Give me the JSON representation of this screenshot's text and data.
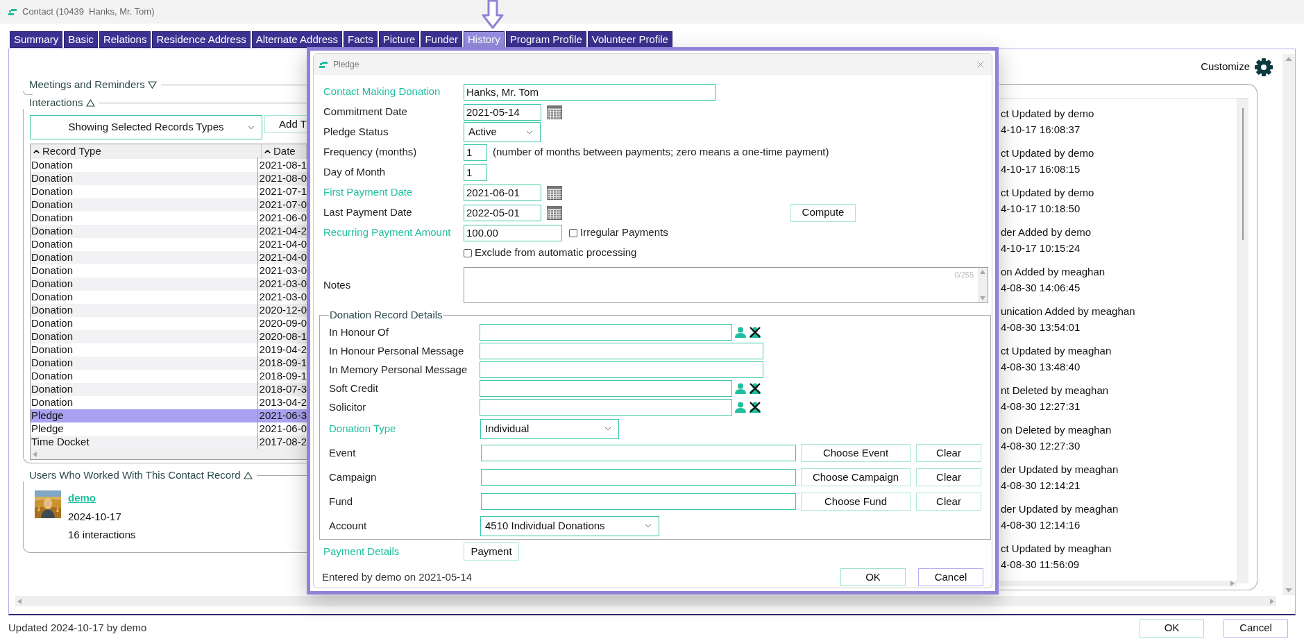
{
  "window": {
    "title": "Contact (10439  Hanks, Mr. Tom)"
  },
  "tabs": [
    {
      "label": "Summary",
      "selected": false
    },
    {
      "label": "Basic",
      "selected": false
    },
    {
      "label": "Relations",
      "selected": false
    },
    {
      "label": "Residence Address",
      "selected": false
    },
    {
      "label": "Alternate Address",
      "selected": false
    },
    {
      "label": "Facts",
      "selected": false
    },
    {
      "label": "Picture",
      "selected": false
    },
    {
      "label": "Funder",
      "selected": false
    },
    {
      "label": "History",
      "selected": true
    },
    {
      "label": "Program Profile",
      "selected": false
    },
    {
      "label": "Volunteer Profile",
      "selected": false
    }
  ],
  "meetings": {
    "title": "Meetings and Reminders",
    "expanded": false
  },
  "interactions": {
    "title": "Interactions",
    "expanded": true,
    "filter": "Showing Selected Records Types",
    "add_button": "Add T",
    "columns": [
      "Record Type",
      "Date"
    ],
    "rows": [
      {
        "record_type": "Donation",
        "date": "2021-08-1",
        "selected": false
      },
      {
        "record_type": "Donation",
        "date": "2021-08-0",
        "selected": false
      },
      {
        "record_type": "Donation",
        "date": "2021-07-1",
        "selected": false
      },
      {
        "record_type": "Donation",
        "date": "2021-07-0",
        "selected": false
      },
      {
        "record_type": "Donation",
        "date": "2021-06-0",
        "selected": false
      },
      {
        "record_type": "Donation",
        "date": "2021-04-2",
        "selected": false
      },
      {
        "record_type": "Donation",
        "date": "2021-04-0",
        "selected": false
      },
      {
        "record_type": "Donation",
        "date": "2021-04-0",
        "selected": false
      },
      {
        "record_type": "Donation",
        "date": "2021-03-0",
        "selected": false
      },
      {
        "record_type": "Donation",
        "date": "2021-03-0",
        "selected": false
      },
      {
        "record_type": "Donation",
        "date": "2021-03-0",
        "selected": false
      },
      {
        "record_type": "Donation",
        "date": "2020-12-0",
        "selected": false
      },
      {
        "record_type": "Donation",
        "date": "2020-09-0",
        "selected": false
      },
      {
        "record_type": "Donation",
        "date": "2020-08-1",
        "selected": false
      },
      {
        "record_type": "Donation",
        "date": "2019-04-2",
        "selected": false
      },
      {
        "record_type": "Donation",
        "date": "2018-09-1",
        "selected": false
      },
      {
        "record_type": "Donation",
        "date": "2018-09-1",
        "selected": false
      },
      {
        "record_type": "Donation",
        "date": "2018-07-3",
        "selected": false
      },
      {
        "record_type": "Donation",
        "date": "2013-04-2",
        "selected": false
      },
      {
        "record_type": "Pledge",
        "date": "2021-06-3",
        "selected": true
      },
      {
        "record_type": "Pledge",
        "date": "2021-06-0",
        "selected": false
      },
      {
        "record_type": "Time Docket",
        "date": "2017-08-2",
        "selected": false
      }
    ]
  },
  "users": {
    "title": "Users Who Worked With This Contact Record",
    "expanded": true,
    "items": [
      {
        "name": "demo",
        "date": "2024-10-17",
        "count": "16 interactions"
      }
    ]
  },
  "customize": "Customize",
  "history": [
    {
      "event": "ct Updated by demo",
      "time": "4-10-17 16:08:37"
    },
    {
      "event": "ct Updated by demo",
      "time": "4-10-17 16:08:15"
    },
    {
      "event": "ct Updated by demo",
      "time": "4-10-17 10:18:50"
    },
    {
      "event": "der Added by demo",
      "time": "4-10-17 10:15:24"
    },
    {
      "event": "on Added by meaghan",
      "time": "4-08-30 14:06:45"
    },
    {
      "event": "unication Added by meaghan",
      "time": "4-08-30 13:54:01"
    },
    {
      "event": "ct Updated by meaghan",
      "time": "4-08-30 13:48:40"
    },
    {
      "event": "nt Deleted by meaghan",
      "time": "4-08-30 12:27:31"
    },
    {
      "event": "on Deleted by meaghan",
      "time": "4-08-30 12:27:30"
    },
    {
      "event": "der Updated by meaghan",
      "time": "4-08-30 12:14:21"
    },
    {
      "event": "der Updated by meaghan",
      "time": "4-08-30 12:14:16"
    },
    {
      "event": "ct Updated by meaghan",
      "time": "4-08-30 11:56:09"
    }
  ],
  "status_bar": "Updated 2024-10-17 by demo",
  "buttons": [
    {
      "label": "OK",
      "kind": "ok"
    },
    {
      "label": "Cancel",
      "kind": "cancel"
    }
  ],
  "dialog": {
    "title": "Pledge",
    "fields": [
      {
        "kind": "text",
        "label": "Contact Making Donation",
        "required": true,
        "value": "Hanks, Mr. Tom"
      },
      {
        "kind": "date",
        "label": "Commitment Date",
        "required": false,
        "value": "2021-05-14"
      },
      {
        "kind": "select",
        "label": "Pledge Status",
        "required": false,
        "value": "Active"
      },
      {
        "kind": "number",
        "label": "Frequency (months)",
        "required": false,
        "value": "1",
        "hint": "(number of months between payments; zero means a one-time payment)"
      },
      {
        "kind": "number",
        "label": "Day of Month",
        "required": false,
        "value": "1"
      },
      {
        "kind": "date",
        "label": "First Payment Date",
        "required": true,
        "value": "2021-06-01"
      },
      {
        "kind": "date",
        "label": "Last Payment Date",
        "required": false,
        "value": "2022-05-01",
        "button": "Compute"
      },
      {
        "kind": "amount",
        "label": "Recurring Payment Amount",
        "required": true,
        "value": "100.00",
        "option": {
          "label": "Irregular Payments",
          "checked": false
        }
      },
      {
        "kind": "option",
        "option": {
          "label": "Exclude from automatic processing",
          "checked": false
        }
      },
      {
        "kind": "notes",
        "label": "Notes",
        "required": false,
        "counter": "0/255"
      }
    ],
    "details": {
      "title": "Donation Record Details",
      "fields": [
        {
          "kind": "contact",
          "label": "In Honour Of",
          "required": false
        },
        {
          "kind": "text",
          "label": "In Honour Personal Message",
          "required": false
        },
        {
          "kind": "text",
          "label": "In Memory Personal Message",
          "required": false
        },
        {
          "kind": "contact",
          "label": "Soft Credit",
          "required": false
        },
        {
          "kind": "contact",
          "label": "Solicitor",
          "required": false
        },
        {
          "kind": "select",
          "label": "Donation Type",
          "required": true,
          "value": "Individual"
        },
        {
          "kind": "chooser",
          "label": "Event",
          "required": false,
          "button": "Choose Event",
          "clear": "Clear"
        },
        {
          "kind": "chooser",
          "label": "Campaign",
          "required": false,
          "button": "Choose Campaign",
          "clear": "Clear"
        },
        {
          "kind": "chooser",
          "label": "Fund",
          "required": false,
          "button": "Choose Fund",
          "clear": "Clear"
        },
        {
          "kind": "select",
          "label": "Account",
          "required": false,
          "value": "4510 Individual Donations"
        }
      ]
    },
    "payment": {
      "label": "Payment Details",
      "required": true,
      "button": "Payment"
    },
    "entered": "Entered by demo on 2021-05-14",
    "buttons": [
      {
        "label": "OK",
        "kind": "ok"
      },
      {
        "label": "Cancel",
        "kind": "cancel"
      }
    ]
  }
}
